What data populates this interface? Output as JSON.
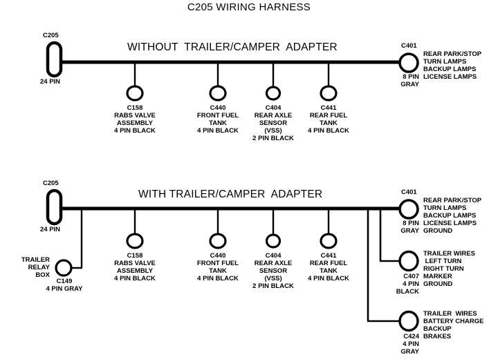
{
  "title": "C205 WIRING HARNESS",
  "colors": {
    "ink": "#000000",
    "background": "#ffffff"
  },
  "diagrams": [
    {
      "id": "without-adapter",
      "header": "WITHOUT  TRAILER/CAMPER  ADAPTER",
      "source": {
        "id": "C205",
        "pins": "24 PIN"
      },
      "drops": [
        {
          "id": "C158",
          "desc": [
            "RABS VALVE",
            "ASSEMBLY"
          ],
          "pins": "4 PIN BLACK"
        },
        {
          "id": "C440",
          "desc": [
            "FRONT FUEL",
            "TANK"
          ],
          "pins": "4 PIN BLACK"
        },
        {
          "id": "C404",
          "desc": [
            "REAR AXLE",
            "SENSOR",
            "(VSS)"
          ],
          "pins": "2 PIN BLACK"
        },
        {
          "id": "C441",
          "desc": [
            "REAR FUEL",
            "TANK"
          ],
          "pins": "4 PIN BLACK"
        }
      ],
      "terminals": [
        {
          "id": "C401",
          "pins_line1": "8 PIN",
          "pins_line2": "GRAY",
          "functions": [
            "REAR PARK/STOP",
            "TURN LAMPS",
            "BACKUP LAMPS",
            "LICENSE LAMPS"
          ]
        }
      ]
    },
    {
      "id": "with-adapter",
      "header": "WITH TRAILER/CAMPER  ADAPTER",
      "source": {
        "id": "C205",
        "pins": "24 PIN"
      },
      "left_branch": {
        "id": "C149",
        "pins": "4 PIN GRAY",
        "desc": [
          "TRAILER",
          "RELAY",
          "BOX"
        ]
      },
      "drops": [
        {
          "id": "C158",
          "desc": [
            "RABS VALVE",
            "ASSEMBLY"
          ],
          "pins": "4 PIN BLACK"
        },
        {
          "id": "C440",
          "desc": [
            "FRONT FUEL",
            "TANK"
          ],
          "pins": "4 PIN BLACK"
        },
        {
          "id": "C404",
          "desc": [
            "REAR AXLE",
            "SENSOR",
            "(VSS)"
          ],
          "pins": "2 PIN BLACK"
        },
        {
          "id": "C441",
          "desc": [
            "REAR FUEL",
            "TANK"
          ],
          "pins": "4 PIN BLACK"
        }
      ],
      "terminals": [
        {
          "id": "C401",
          "pins_line1": "8 PIN",
          "pins_line2": "GRAY",
          "functions": [
            "REAR PARK/STOP",
            "TURN LAMPS",
            "BACKUP LAMPS",
            "LICENSE LAMPS",
            "GROUND"
          ]
        },
        {
          "id": "C407",
          "pins_line1": "4 PIN",
          "pins_line2": "BLACK",
          "functions": [
            "TRAILER WIRES",
            " LEFT TURN",
            "RIGHT TURN",
            "MARKER",
            "GROUND"
          ]
        },
        {
          "id": "C424",
          "pins_line1": "4 PIN",
          "pins_line2": "GRAY",
          "functions": [
            "TRAILER  WIRES",
            "BATTERY CHARGE",
            "BACKUP",
            "BRAKES"
          ]
        }
      ]
    }
  ]
}
